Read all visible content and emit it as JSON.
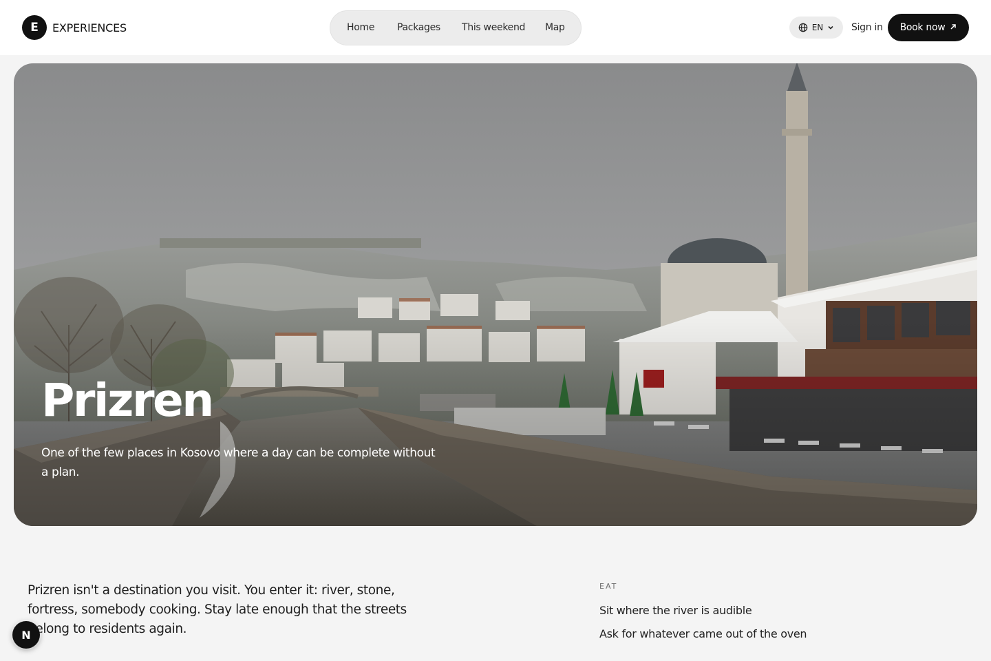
{
  "header": {
    "brand_mark": "E",
    "brand_name": "EXPERIENCES",
    "nav": [
      {
        "label": "Home"
      },
      {
        "label": "Packages"
      },
      {
        "label": "This weekend"
      },
      {
        "label": "Map"
      }
    ],
    "language": "EN",
    "sign_in": "Sign in",
    "book_now": "Book now"
  },
  "hero": {
    "title": "Prizren",
    "subtitle": "One of the few places in Kosovo where a day can be complete without a plan."
  },
  "intro": {
    "text": "Prizren isn't a destination you visit. You enter it: river, stone, fortress, somebody cooking. Stay late enough that the streets belong to residents again."
  },
  "eat": {
    "label": "EAT",
    "items": [
      "Sit where the river is audible",
      "Ask for whatever came out of the oven"
    ]
  },
  "dev_badge": "N",
  "icons": {
    "language": "globe-icon",
    "language_caret": "chevron-down-icon",
    "book": "arrow-up-right-icon"
  },
  "colors": {
    "primary": "#111111",
    "background": "#f4f4f4",
    "pill": "#ececec"
  }
}
